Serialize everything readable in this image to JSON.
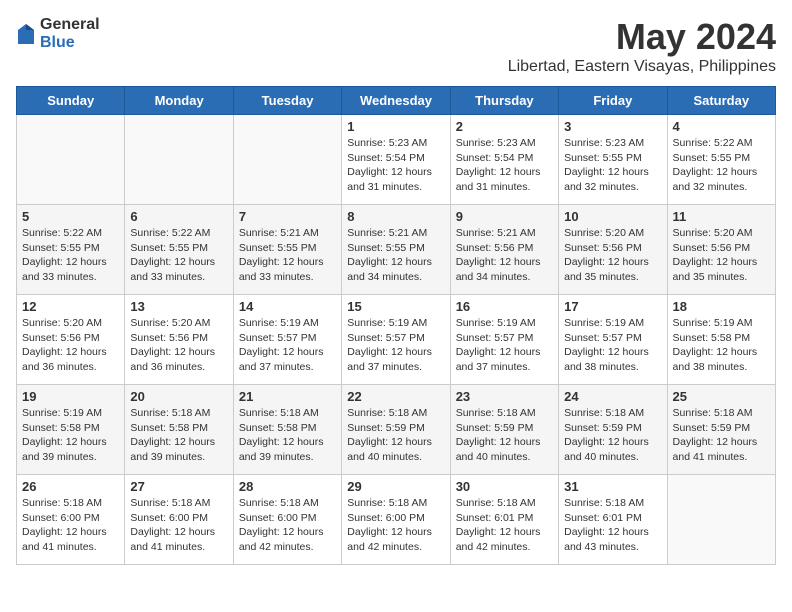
{
  "logo": {
    "general": "General",
    "blue": "Blue"
  },
  "title": "May 2024",
  "subtitle": "Libertad, Eastern Visayas, Philippines",
  "days": [
    "Sunday",
    "Monday",
    "Tuesday",
    "Wednesday",
    "Thursday",
    "Friday",
    "Saturday"
  ],
  "weeks": [
    [
      {
        "date": "",
        "sunrise": "",
        "sunset": "",
        "daylight": ""
      },
      {
        "date": "",
        "sunrise": "",
        "sunset": "",
        "daylight": ""
      },
      {
        "date": "",
        "sunrise": "",
        "sunset": "",
        "daylight": ""
      },
      {
        "date": "1",
        "sunrise": "Sunrise: 5:23 AM",
        "sunset": "Sunset: 5:54 PM",
        "daylight": "Daylight: 12 hours and 31 minutes."
      },
      {
        "date": "2",
        "sunrise": "Sunrise: 5:23 AM",
        "sunset": "Sunset: 5:54 PM",
        "daylight": "Daylight: 12 hours and 31 minutes."
      },
      {
        "date": "3",
        "sunrise": "Sunrise: 5:23 AM",
        "sunset": "Sunset: 5:55 PM",
        "daylight": "Daylight: 12 hours and 32 minutes."
      },
      {
        "date": "4",
        "sunrise": "Sunrise: 5:22 AM",
        "sunset": "Sunset: 5:55 PM",
        "daylight": "Daylight: 12 hours and 32 minutes."
      }
    ],
    [
      {
        "date": "5",
        "sunrise": "Sunrise: 5:22 AM",
        "sunset": "Sunset: 5:55 PM",
        "daylight": "Daylight: 12 hours and 33 minutes."
      },
      {
        "date": "6",
        "sunrise": "Sunrise: 5:22 AM",
        "sunset": "Sunset: 5:55 PM",
        "daylight": "Daylight: 12 hours and 33 minutes."
      },
      {
        "date": "7",
        "sunrise": "Sunrise: 5:21 AM",
        "sunset": "Sunset: 5:55 PM",
        "daylight": "Daylight: 12 hours and 33 minutes."
      },
      {
        "date": "8",
        "sunrise": "Sunrise: 5:21 AM",
        "sunset": "Sunset: 5:55 PM",
        "daylight": "Daylight: 12 hours and 34 minutes."
      },
      {
        "date": "9",
        "sunrise": "Sunrise: 5:21 AM",
        "sunset": "Sunset: 5:56 PM",
        "daylight": "Daylight: 12 hours and 34 minutes."
      },
      {
        "date": "10",
        "sunrise": "Sunrise: 5:20 AM",
        "sunset": "Sunset: 5:56 PM",
        "daylight": "Daylight: 12 hours and 35 minutes."
      },
      {
        "date": "11",
        "sunrise": "Sunrise: 5:20 AM",
        "sunset": "Sunset: 5:56 PM",
        "daylight": "Daylight: 12 hours and 35 minutes."
      }
    ],
    [
      {
        "date": "12",
        "sunrise": "Sunrise: 5:20 AM",
        "sunset": "Sunset: 5:56 PM",
        "daylight": "Daylight: 12 hours and 36 minutes."
      },
      {
        "date": "13",
        "sunrise": "Sunrise: 5:20 AM",
        "sunset": "Sunset: 5:56 PM",
        "daylight": "Daylight: 12 hours and 36 minutes."
      },
      {
        "date": "14",
        "sunrise": "Sunrise: 5:19 AM",
        "sunset": "Sunset: 5:57 PM",
        "daylight": "Daylight: 12 hours and 37 minutes."
      },
      {
        "date": "15",
        "sunrise": "Sunrise: 5:19 AM",
        "sunset": "Sunset: 5:57 PM",
        "daylight": "Daylight: 12 hours and 37 minutes."
      },
      {
        "date": "16",
        "sunrise": "Sunrise: 5:19 AM",
        "sunset": "Sunset: 5:57 PM",
        "daylight": "Daylight: 12 hours and 37 minutes."
      },
      {
        "date": "17",
        "sunrise": "Sunrise: 5:19 AM",
        "sunset": "Sunset: 5:57 PM",
        "daylight": "Daylight: 12 hours and 38 minutes."
      },
      {
        "date": "18",
        "sunrise": "Sunrise: 5:19 AM",
        "sunset": "Sunset: 5:58 PM",
        "daylight": "Daylight: 12 hours and 38 minutes."
      }
    ],
    [
      {
        "date": "19",
        "sunrise": "Sunrise: 5:19 AM",
        "sunset": "Sunset: 5:58 PM",
        "daylight": "Daylight: 12 hours and 39 minutes."
      },
      {
        "date": "20",
        "sunrise": "Sunrise: 5:18 AM",
        "sunset": "Sunset: 5:58 PM",
        "daylight": "Daylight: 12 hours and 39 minutes."
      },
      {
        "date": "21",
        "sunrise": "Sunrise: 5:18 AM",
        "sunset": "Sunset: 5:58 PM",
        "daylight": "Daylight: 12 hours and 39 minutes."
      },
      {
        "date": "22",
        "sunrise": "Sunrise: 5:18 AM",
        "sunset": "Sunset: 5:59 PM",
        "daylight": "Daylight: 12 hours and 40 minutes."
      },
      {
        "date": "23",
        "sunrise": "Sunrise: 5:18 AM",
        "sunset": "Sunset: 5:59 PM",
        "daylight": "Daylight: 12 hours and 40 minutes."
      },
      {
        "date": "24",
        "sunrise": "Sunrise: 5:18 AM",
        "sunset": "Sunset: 5:59 PM",
        "daylight": "Daylight: 12 hours and 40 minutes."
      },
      {
        "date": "25",
        "sunrise": "Sunrise: 5:18 AM",
        "sunset": "Sunset: 5:59 PM",
        "daylight": "Daylight: 12 hours and 41 minutes."
      }
    ],
    [
      {
        "date": "26",
        "sunrise": "Sunrise: 5:18 AM",
        "sunset": "Sunset: 6:00 PM",
        "daylight": "Daylight: 12 hours and 41 minutes."
      },
      {
        "date": "27",
        "sunrise": "Sunrise: 5:18 AM",
        "sunset": "Sunset: 6:00 PM",
        "daylight": "Daylight: 12 hours and 41 minutes."
      },
      {
        "date": "28",
        "sunrise": "Sunrise: 5:18 AM",
        "sunset": "Sunset: 6:00 PM",
        "daylight": "Daylight: 12 hours and 42 minutes."
      },
      {
        "date": "29",
        "sunrise": "Sunrise: 5:18 AM",
        "sunset": "Sunset: 6:00 PM",
        "daylight": "Daylight: 12 hours and 42 minutes."
      },
      {
        "date": "30",
        "sunrise": "Sunrise: 5:18 AM",
        "sunset": "Sunset: 6:01 PM",
        "daylight": "Daylight: 12 hours and 42 minutes."
      },
      {
        "date": "31",
        "sunrise": "Sunrise: 5:18 AM",
        "sunset": "Sunset: 6:01 PM",
        "daylight": "Daylight: 12 hours and 43 minutes."
      },
      {
        "date": "",
        "sunrise": "",
        "sunset": "",
        "daylight": ""
      }
    ]
  ]
}
